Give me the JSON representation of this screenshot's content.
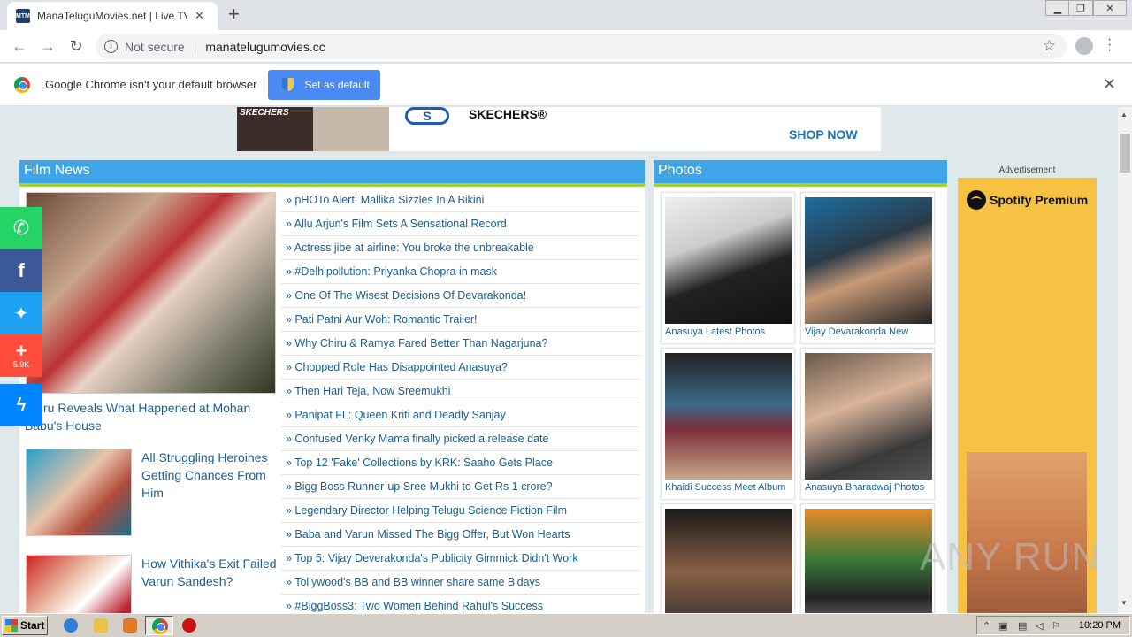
{
  "browser": {
    "tab_title": "ManaTeluguMovies.net | Live TV | Sh",
    "tab_favicon": "MTM",
    "not_secure": "Not secure",
    "url": "manatelugumovies.cc"
  },
  "infobar": {
    "message": "Google Chrome isn't your default browser",
    "button": "Set as default"
  },
  "ad_banner": {
    "image_brand": "SKECHERS",
    "logo": "S",
    "brand": "SKECHERS®",
    "cta": "SHOP NOW"
  },
  "film_news": {
    "header": "Film News",
    "featured_caption": "Chiru Reveals What Happened at Mohan Babu's House",
    "stories": [
      {
        "title": "All Struggling Heroines Getting Chances From Him"
      },
      {
        "title": "How Vithika's Exit Failed Varun Sandesh?"
      }
    ],
    "headlines": [
      "» pHOTo Alert: Mallika Sizzles In A Bikini",
      "» Allu Arjun's Film Sets A Sensational Record",
      "» Actress jibe at airline: You broke the unbreakable",
      "» #Delhipollution: Priyanka Chopra in mask",
      "» One Of The Wisest Decisions Of Devarakonda!",
      "» Pati Patni Aur Woh: Romantic Trailer!",
      "» Why Chiru & Ramya Fared Better Than Nagarjuna?",
      "» Chopped Role Has Disappointed Anasuya?",
      "» Then Hari Teja, Now Sreemukhi",
      "» Panipat FL: Queen Kriti and Deadly Sanjay",
      "» Confused Venky Mama finally picked a release date",
      "» Top 12 'Fake' Collections by KRK: Saaho Gets Place",
      "» Bigg Boss Runner-up Sree Mukhi to Get Rs 1 crore?",
      "» Legendary Director Helping Telugu Science Fiction Film",
      "» Baba and Varun Missed The Bigg Offer, But Won Hearts",
      "» Top 5: Vijay Deverakonda's Publicity Gimmick Didn't Work",
      "» Tollywood's BB and BB winner share same B'days",
      "» #BiggBoss3: Two Women Behind Rahul's Success"
    ]
  },
  "photos": {
    "header": "Photos",
    "items": [
      {
        "caption": "Anasuya Latest Photos"
      },
      {
        "caption": "Vijay Devarakonda New"
      },
      {
        "caption": "Khaidi Success Meet Album"
      },
      {
        "caption": "Anasuya Bharadwaj Photos"
      },
      {
        "caption": ""
      },
      {
        "caption": ""
      }
    ]
  },
  "right_ad": {
    "label": "Advertisement",
    "brand": "Spotify Premium"
  },
  "share": {
    "count": "5.9K"
  },
  "watermark": "ANY RUN",
  "taskbar": {
    "start": "Start",
    "clock": "10:20 PM"
  }
}
